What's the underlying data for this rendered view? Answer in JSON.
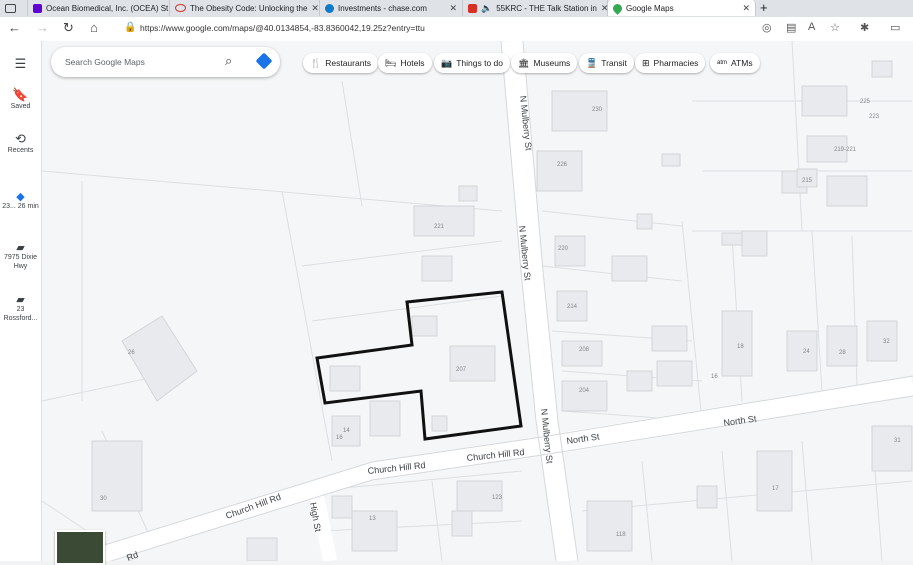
{
  "tabs": [
    {
      "label": "",
      "icon": "tab-list-icon"
    },
    {
      "label": "Ocean Biomedical, Inc. (OCEA) St",
      "icon": "yahoo-icon",
      "color": "#5f01d1"
    },
    {
      "label": "The Obesity Code: Unlocking the",
      "icon": "loading-icon",
      "color": "#d93025"
    },
    {
      "label": "Investments - chase.com",
      "icon": "chase-icon",
      "color": "#117aca"
    },
    {
      "label": "55KRC - THE Talk Station in",
      "icon": "radio-icon",
      "color": "#d93025"
    },
    {
      "label": "Google Maps",
      "icon": "maps-icon",
      "color": "#34a853"
    }
  ],
  "new_tab": "+",
  "url": "https://www.google.com/maps/@40.0134854,-83.8360042,19.25z?entry=ttu",
  "rail": [
    {
      "icon": "menu-icon",
      "label": ""
    },
    {
      "icon": "bookmark-icon",
      "label": "Saved"
    },
    {
      "icon": "history-icon",
      "label": "Recents"
    },
    {
      "icon": "directions-icon",
      "label": "23... 26 min"
    },
    {
      "icon": "place-icon",
      "label": "7975 Dixie Hwy"
    },
    {
      "icon": "place-icon",
      "label": "23 Rossford..."
    }
  ],
  "search": {
    "placeholder": "Search Google Maps"
  },
  "chips": [
    {
      "label": "Restaurants",
      "icon": "fork-knife-icon"
    },
    {
      "label": "Hotels",
      "icon": "bed-icon"
    },
    {
      "label": "Things to do",
      "icon": "camera-icon"
    },
    {
      "label": "Museums",
      "icon": "museum-icon"
    },
    {
      "label": "Transit",
      "icon": "train-icon"
    },
    {
      "label": "Pharmacies",
      "icon": "pharmacy-icon"
    },
    {
      "label": "ATMs",
      "icon": "atm-icon"
    }
  ],
  "streets": {
    "mulberry_top": "N Mulberry St",
    "mulberry_mid": "N Mulberry St",
    "mulberry_low": "N Mulberry St",
    "north_st_left": "North St",
    "north_st_right": "North St",
    "church_hill_1": "Church Hill Rd",
    "church_hill_2": "Church Hill Rd",
    "church_hill_3": "Church Hill Rd",
    "high_st": "High St",
    "rd_partial": "Rd"
  },
  "house_numbers": [
    "230",
    "225",
    "223",
    "226",
    "219-221",
    "215",
    "221",
    "220",
    "214",
    "208",
    "204",
    "207",
    "18",
    "24",
    "28",
    "32",
    "16",
    "26",
    "14",
    "16",
    "30",
    "123",
    "13",
    "118",
    "17",
    "31"
  ]
}
